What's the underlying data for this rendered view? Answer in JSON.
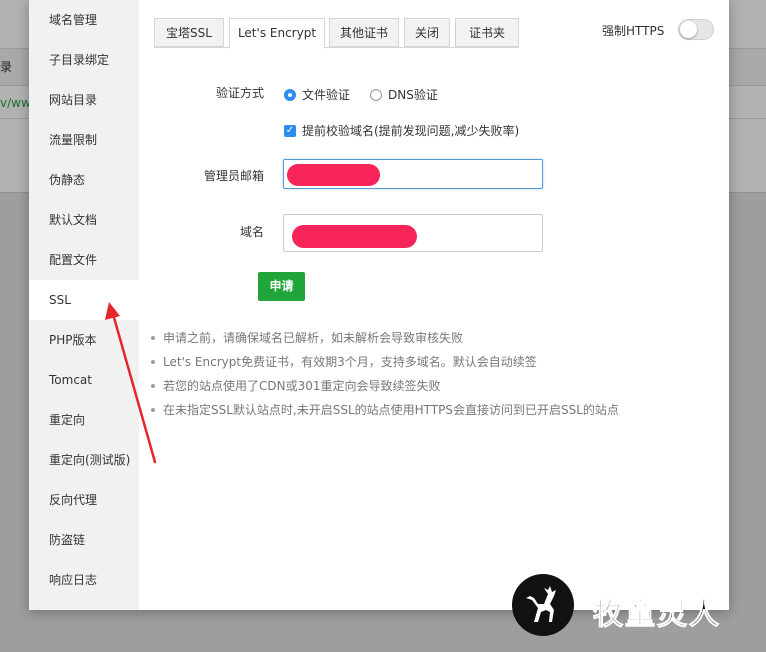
{
  "background": {
    "column_header_fragment": "录",
    "link_fragment": "v/www"
  },
  "sidebar": {
    "items": [
      {
        "label": "域名管理"
      },
      {
        "label": "子目录绑定"
      },
      {
        "label": "网站目录"
      },
      {
        "label": "流量限制"
      },
      {
        "label": "伪静态"
      },
      {
        "label": "默认文档"
      },
      {
        "label": "配置文件"
      },
      {
        "label": "SSL",
        "active": true
      },
      {
        "label": "PHP版本"
      },
      {
        "label": "Tomcat"
      },
      {
        "label": "重定向"
      },
      {
        "label": "重定向(测试版)"
      },
      {
        "label": "反向代理"
      },
      {
        "label": "防盗链"
      },
      {
        "label": "响应日志"
      }
    ]
  },
  "tabs": [
    {
      "label": "宝塔SSL"
    },
    {
      "label": "Let's Encrypt",
      "active": true
    },
    {
      "label": "其他证书"
    },
    {
      "label": "关闭"
    },
    {
      "label": "证书夹"
    }
  ],
  "force_https": {
    "label": "强制HTTPS",
    "enabled": false
  },
  "form": {
    "verify_label": "验证方式",
    "verify_options": [
      {
        "label": "文件验证",
        "checked": true
      },
      {
        "label": "DNS验证",
        "checked": false
      }
    ],
    "precheck_label": "提前校验域名(提前发现问题,减少失败率)",
    "precheck_checked": true,
    "email_label": "管理员邮箱",
    "domain_label": "域名",
    "apply_label": "申请"
  },
  "tips": [
    "申请之前，请确保域名已解析，如未解析会导致审核失败",
    "Let's Encrypt免费证书，有效期3个月，支持多域名。默认会自动续签",
    "若您的站点使用了CDN或301重定向会导致续签失败",
    "在未指定SSL默认站点时,未开启SSL的站点使用HTTPS会直接访问到已开启SSL的站点"
  ],
  "colors": {
    "accent_green": "#20a53a",
    "radio_blue": "#2d8cf0",
    "annotation_red": "#e5262b",
    "redaction": "#f7245a"
  },
  "watermark": {
    "text": "牧童灵人",
    "icon": "deer-icon"
  }
}
